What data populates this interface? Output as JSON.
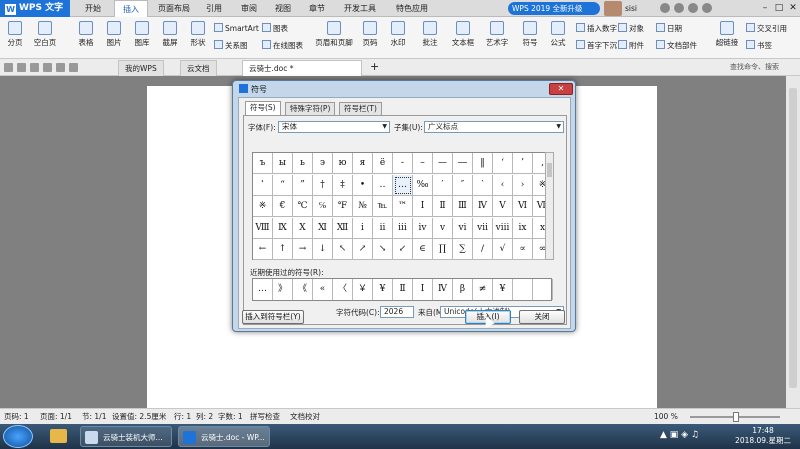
{
  "titlebar": {
    "app_name": "WPS 文字",
    "menu_tabs": [
      "开始",
      "插入",
      "页面布局",
      "引用",
      "审阅",
      "视图",
      "章节",
      "开发工具",
      "特色应用"
    ],
    "active_tab": "插入",
    "upgrade_label": "WPS 2019 全新升级",
    "username": "sisi"
  },
  "ribbon": {
    "items": [
      "分页",
      "空白页",
      "表格",
      "图片",
      "图库",
      "截屏",
      "形状",
      "关系图",
      "在线图表",
      "页眉和页脚",
      "页码",
      "水印",
      "批注",
      "文本框",
      "艺术字",
      "符号",
      "公式",
      "首字下沉",
      "附件",
      "文档部件",
      "超链接",
      "书签"
    ],
    "small_items": [
      "SmartArt",
      "图表",
      "插入数字",
      "对象",
      "日期",
      "交叉引用"
    ]
  },
  "tabbar": {
    "tabs": [
      "我的WPS",
      "云文档",
      "云骑士.doc *"
    ],
    "active_tab": "云骑士.doc *",
    "search_placeholder": "查找命令、搜索"
  },
  "dialog": {
    "title": "符号",
    "tabs": [
      "符号(S)",
      "特殊字符(P)",
      "符号栏(T)"
    ],
    "active_tab": "符号(S)",
    "font_label": "字体(F):",
    "font_value": "宋体",
    "subset_label": "子集(U):",
    "subset_value": "广义标点",
    "grid_rows": [
      [
        "ъ",
        "ы",
        "ь",
        "э",
        "ю",
        "я",
        "ё",
        "‐",
        "–",
        "—",
        "―",
        "‖",
        "‘",
        "’",
        "‚"
      ],
      [
        "‛",
        "“",
        "”",
        "†",
        "‡",
        "•",
        "‥",
        "…",
        "‰",
        "′",
        "″",
        "‵",
        "‹",
        "›",
        "※"
      ],
      [
        "※",
        "€",
        "℃",
        "℅",
        "℉",
        "№",
        "℡",
        "™",
        "Ⅰ",
        "Ⅱ",
        "Ⅲ",
        "Ⅳ",
        "Ⅴ",
        "Ⅵ",
        "Ⅶ"
      ],
      [
        "Ⅷ",
        "Ⅸ",
        "Ⅹ",
        "Ⅺ",
        "Ⅻ",
        "ⅰ",
        "ⅱ",
        "ⅲ",
        "ⅳ",
        "ⅴ",
        "ⅵ",
        "ⅶ",
        "ⅷ",
        "ⅸ",
        "ⅹ"
      ],
      [
        "←",
        "↑",
        "→",
        "↓",
        "↖",
        "↗",
        "↘",
        "↙",
        "∈",
        "∏",
        "∑",
        "∕",
        "√",
        "∝",
        "∞"
      ]
    ],
    "selected_symbol": "…",
    "recent_label": "近期使用过的符号(R):",
    "recent_symbols": [
      "…",
      "》",
      "《",
      "«",
      "〈",
      "￥",
      "¥",
      "Ⅱ",
      "Ⅰ",
      "Ⅳ",
      "β",
      "≠",
      "¥",
      "",
      ""
    ],
    "code_label": "字符代码(C):",
    "code_value": "2026",
    "from_label": "来自(M)",
    "from_value": "Unicode(十六进制)",
    "insert_to_bar_button": "插入到符号栏(Y)",
    "insert_button": "插入(I)",
    "close_button": "关闭"
  },
  "statusbar": {
    "page": "页码: 1",
    "pages": "页面: 1/1",
    "section": "节: 1/1",
    "position": "设置值: 2.5厘米",
    "row": "行: 1",
    "col": "列: 2",
    "words": "字数: 1",
    "spellcheck": "拼写检查",
    "docproof": "文档校对",
    "zoom": "100 %",
    "zoom_percent": 100
  },
  "taskbar": {
    "items": [
      "云骑士装机大师...",
      "云骑士.doc - WP..."
    ],
    "time": "17:48",
    "date": "2018.09.星期二"
  },
  "colors": {
    "accent": "#1e73d8",
    "taskbar": "#2a4560",
    "dialog_frame": "#c3d6ea"
  }
}
